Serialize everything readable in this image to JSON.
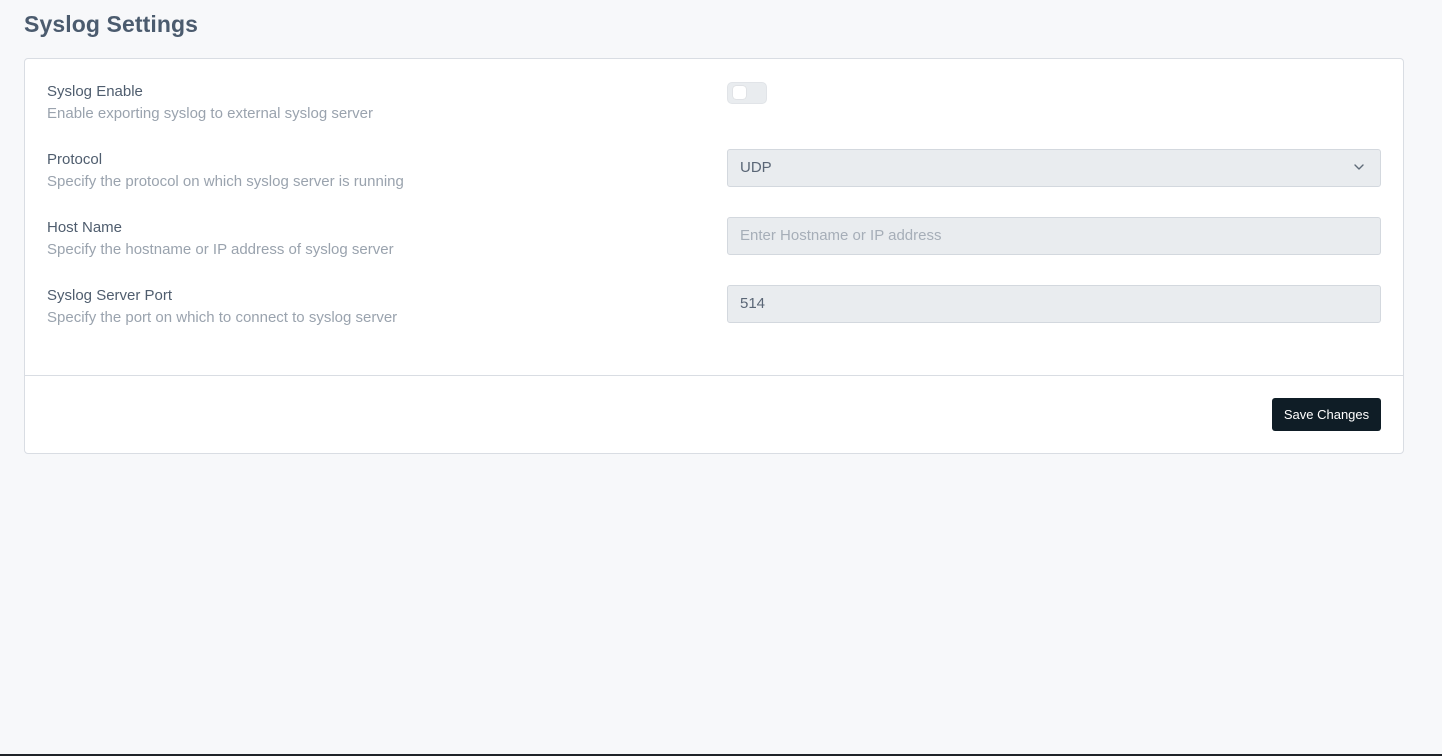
{
  "page": {
    "title": "Syslog Settings"
  },
  "settings": {
    "syslog_enable": {
      "label": "Syslog Enable",
      "description": "Enable exporting syslog to external syslog server",
      "enabled": false
    },
    "protocol": {
      "label": "Protocol",
      "description": "Specify the protocol on which syslog server is running",
      "value": "UDP",
      "icon": "chevron-down-icon"
    },
    "host_name": {
      "label": "Host Name",
      "description": "Specify the hostname or IP address of syslog server",
      "value": "",
      "placeholder": "Enter Hostname or IP address"
    },
    "server_port": {
      "label": "Syslog Server Port",
      "description": "Specify the port on which to connect to syslog server",
      "value": "514"
    }
  },
  "actions": {
    "save_label": "Save Changes"
  },
  "colors": {
    "background": "#f7f8fa",
    "card": "#ffffff",
    "field": "#e9ecef",
    "button": "#0f1d26",
    "title": "#4b5b6e"
  }
}
